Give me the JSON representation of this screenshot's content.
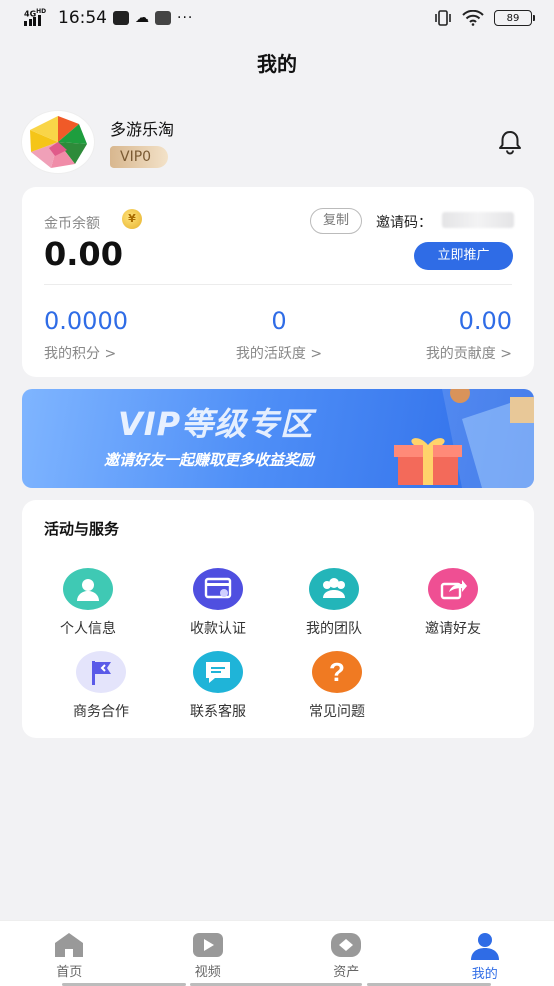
{
  "status_bar": {
    "network": "4G",
    "network_sup": "HD",
    "time": "16:54",
    "dots": "···",
    "battery": "89"
  },
  "page_title": "我的",
  "profile": {
    "name": "多游乐淘",
    "vip": "VIP0"
  },
  "wallet": {
    "coin_label": "金币余额",
    "coin_symbol": "¥",
    "balance": "0.00",
    "copy_label": "复制",
    "invite_label": "邀请码：",
    "promote_label": "立即推广",
    "stats": [
      {
        "value": "0.0000",
        "label": "我的积分 >"
      },
      {
        "value": "0",
        "label": "我的活跃度 >"
      },
      {
        "value": "0.00",
        "label": "我的贡献度 >"
      }
    ]
  },
  "banner": {
    "title": "VIP等级专区",
    "subtitle": "邀请好友一起赚取更多收益奖励"
  },
  "services": {
    "title": "活动与服务",
    "items": [
      {
        "label": "个人信息",
        "icon": "user-icon",
        "color": "#3fc9b4"
      },
      {
        "label": "收款认证",
        "icon": "card-link-icon",
        "color": "#4f4fe0"
      },
      {
        "label": "我的团队",
        "icon": "team-icon",
        "color": "#23b5b9"
      },
      {
        "label": "邀请好友",
        "icon": "share-icon",
        "color": "#ef4f93"
      },
      {
        "label": "商务合作",
        "icon": "flag-icon",
        "color": "#5a5ae8"
      },
      {
        "label": "联系客服",
        "icon": "chat-icon",
        "color": "#1fb4d8"
      },
      {
        "label": "常见问题",
        "icon": "question-icon",
        "color": "#f07a22"
      }
    ]
  },
  "bottom_nav": [
    {
      "label": "首页",
      "icon": "home-icon"
    },
    {
      "label": "视频",
      "icon": "play-icon"
    },
    {
      "label": "资产",
      "icon": "diamond-icon"
    },
    {
      "label": "我的",
      "icon": "person-icon",
      "active": true
    }
  ],
  "colors": {
    "accent": "#2f6ce6",
    "background": "#f2f2f4"
  }
}
